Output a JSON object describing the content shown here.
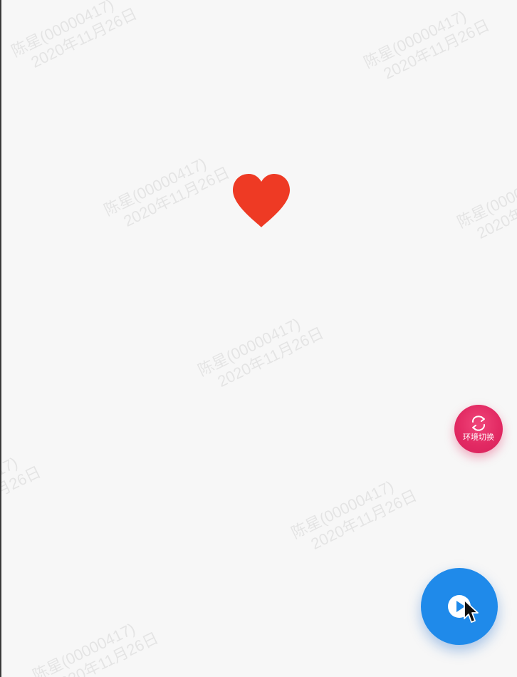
{
  "watermark": {
    "line1": "陈星(00000417)",
    "line2": "2020年11月26日"
  },
  "floating": {
    "env_switch_label": "环境切换"
  },
  "colors": {
    "background": "#f7f7f7",
    "heart": "#ee3a24",
    "env_switch": "#e22a63",
    "play_button": "#1f8aea"
  },
  "icons": {
    "heart": "heart-icon",
    "env_switch": "refresh-cycle-icon",
    "play": "play-circle-icon",
    "cursor": "mouse-pointer-icon"
  }
}
